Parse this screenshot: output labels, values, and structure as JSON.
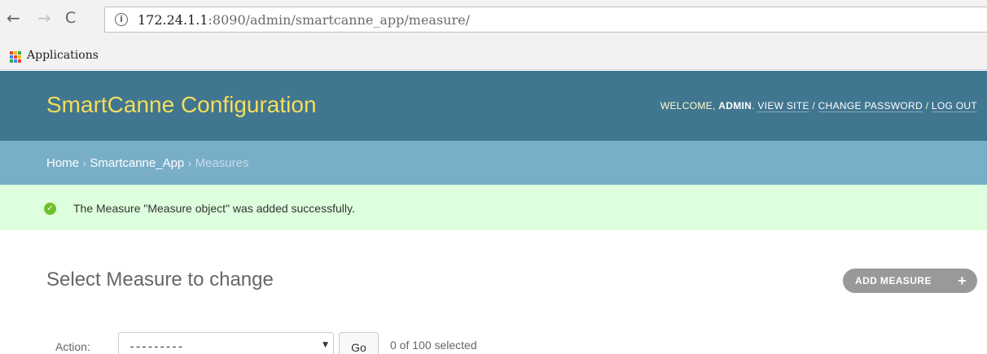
{
  "browser": {
    "url_host": "172.24.1.1",
    "url_rest": ":8090/admin/smartcanne_app/measure/",
    "bookmark_label": "Applications",
    "icons": [
      "back-arrow-icon",
      "forward-arrow-icon",
      "reload-icon",
      "info-icon",
      "apps-grid-icon"
    ]
  },
  "header": {
    "brand": "SmartCanne Configuration",
    "welcome": "WELCOME,",
    "username": "ADMIN",
    "view_site": "VIEW SITE",
    "change_password": "CHANGE PASSWORD",
    "log_out": "LOG OUT",
    "separator": "/",
    "brand_color": "#f5dd5d",
    "header_color": "#417690"
  },
  "breadcrumbs": {
    "home": "Home",
    "app": "Smartcanne_App",
    "current": "Measures",
    "separator": "›"
  },
  "message": {
    "text": "The Measure \"Measure object\" was added successfully.",
    "status": "success",
    "background": "#dfd"
  },
  "content": {
    "title": "Select Measure to change",
    "add_button": "ADD MEASURE"
  },
  "actions": {
    "label": "Action:",
    "selected_value": "---------",
    "go": "Go",
    "counter": "0 of 100 selected"
  }
}
